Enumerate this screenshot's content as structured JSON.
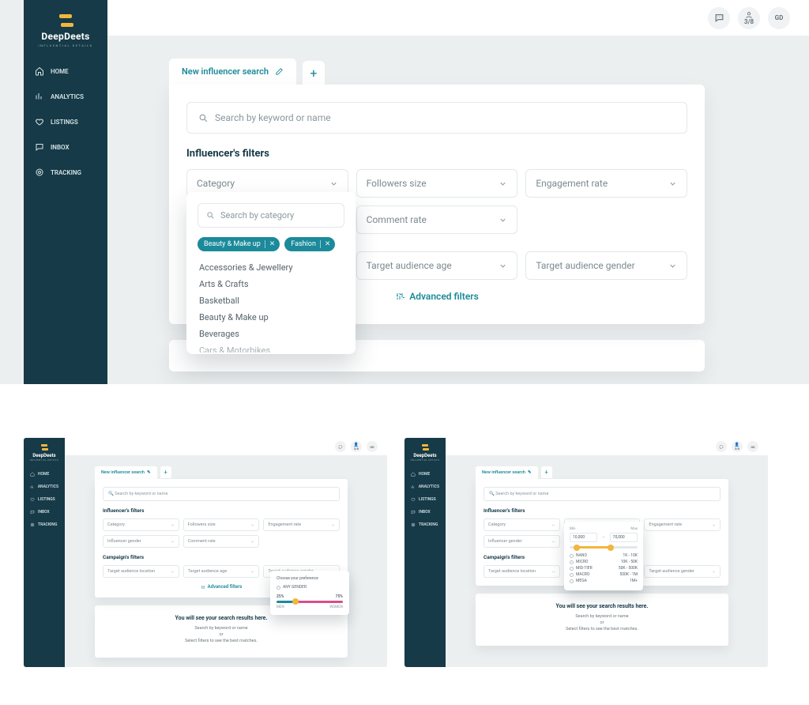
{
  "brand": {
    "name": "DeepDeets",
    "tagline": "INFLUENTIAL DETAILS"
  },
  "nav": {
    "items": [
      {
        "label": "HOME"
      },
      {
        "label": "ANALYTICS"
      },
      {
        "label": "LISTINGS"
      },
      {
        "label": "INBOX"
      },
      {
        "label": "TRACKING"
      }
    ]
  },
  "topbar": {
    "counter": "3/8",
    "avatar_initials": "GD"
  },
  "tab": {
    "label": "New influencer search"
  },
  "search": {
    "placeholder": "Search by keyword or name"
  },
  "sections": {
    "influencer": "Influencer's filters",
    "campaign": "Campaign's filters"
  },
  "filters": {
    "category": "Category",
    "followers": "Followers size",
    "engagement": "Engagement rate",
    "gender": "Influencer gender",
    "comment": "Comment rate",
    "target_location": "Target audience location",
    "target_age": "Target audience age",
    "target_gender": "Target audience gender"
  },
  "advanced": "Advanced filters",
  "category_dropdown": {
    "search_placeholder": "Search by category",
    "selected": [
      "Beauty & Make up",
      "Fashion"
    ],
    "options": [
      "Accessories & Jewellery",
      "Arts & Crafts",
      "Basketball",
      "Beauty & Make up",
      "Beverages",
      "Cars & Motorbikes"
    ]
  },
  "results_empty": {
    "title": "You will see your search results here.",
    "line1": "Search by keyword or name",
    "or": "or",
    "line2": "Select filters to see the best matches."
  },
  "gender_pop": {
    "header": "Choose your preference",
    "any": "ANY GENDER",
    "pct_left": "25%",
    "pct_right": "75%",
    "end_left": "MEN",
    "end_right": "WOMEN"
  },
  "followers_pop": {
    "min_label": "Min",
    "max_label": "Max",
    "min_val": "10,000",
    "max_val": "70,000",
    "tiers": [
      {
        "name": "NANO",
        "range": "1K - 10K"
      },
      {
        "name": "MICRO",
        "range": "10K - 50K"
      },
      {
        "name": "MID-TIER",
        "range": "50K - 500K"
      },
      {
        "name": "MACRO",
        "range": "500K - 1M"
      },
      {
        "name": "MEGA",
        "range": "1M+"
      }
    ]
  }
}
